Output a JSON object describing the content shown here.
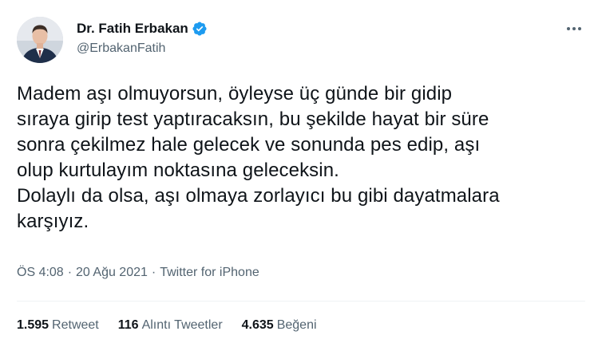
{
  "author": {
    "display_name": "Dr. Fatih Erbakan",
    "handle": "@ErbakanFatih",
    "verified_icon": "verified-badge-icon",
    "verified_color": "#1d9bf0"
  },
  "tweet": {
    "text": "Madem aşı olmuyorsun, öyleyse üç günde bir gidip\nsıraya girip test yaptıracaksın, bu şekilde hayat bir süre\nsonra çekilmez hale gelecek ve sonunda pes edip, aşı\nolup kurtulayım noktasına geleceksin.\nDolaylı da olsa, aşı olmaya zorlayıcı bu gibi dayatmalara\nkarşıyız."
  },
  "meta": {
    "time": "ÖS 4:08",
    "separator": "·",
    "date": "20 Ağu 2021",
    "source": "Twitter for iPhone"
  },
  "stats": {
    "retweets_count": "1.595",
    "retweets_label": "Retweet",
    "quotes_count": "116",
    "quotes_label": "Alıntı Tweetler",
    "likes_count": "4.635",
    "likes_label": "Beğeni"
  },
  "menu_icon": "more-options-icon",
  "colors": {
    "text_primary": "#0f1419",
    "text_secondary": "#536471",
    "divider": "#eff3f4"
  }
}
